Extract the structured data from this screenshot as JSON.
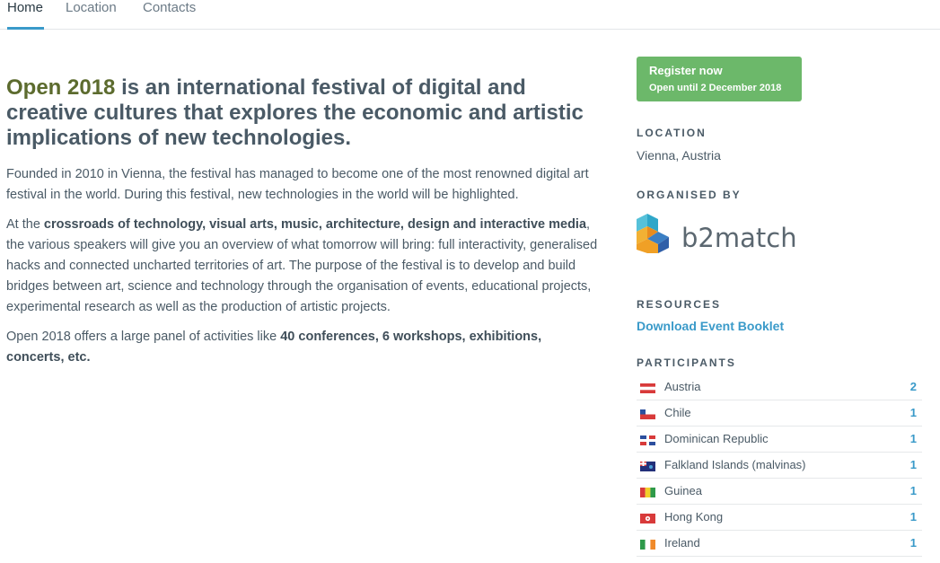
{
  "nav": {
    "tabs": [
      {
        "label": "Home",
        "active": true
      },
      {
        "label": "Location",
        "active": false
      },
      {
        "label": "Contacts",
        "active": false
      }
    ]
  },
  "main": {
    "headline_accent": "Open 2018",
    "headline_rest": " is an international festival of digital and creative cultures that explores the economic and artistic implications of new technologies.",
    "p1": "Founded in 2010 in Vienna, the festival has managed to become one of the most renowned digital art festival in the world. During this festival, new technologies in the world will be highlighted.",
    "p2_a": "At the ",
    "p2_b": "crossroads of technology, visual arts, music, architecture, design and interactive media",
    "p2_c": ", the various speakers will give you an overview of what tomorrow will bring: full interactivity, generalised hacks and connected uncharted territories of art. The purpose of the festival is to develop and build bridges between art, science and technology through the organisation of events, educational projects, experimental research as well as the production of artistic projects.",
    "p3_a": "Open 2018 offers a large panel of activities like ",
    "p3_b": "40 conferences, 6 workshops, exhibitions, concerts, etc."
  },
  "sidebar": {
    "register": {
      "title": "Register now",
      "subtitle": "Open until 2 December 2018"
    },
    "location": {
      "title": "LOCATION",
      "value": "Vienna, Austria"
    },
    "organised": {
      "title": "ORGANISED BY",
      "logo_text": "b2match"
    },
    "resources": {
      "title": "RESOURCES",
      "link": "Download Event Booklet"
    },
    "participants": {
      "title": "PARTICIPANTS",
      "rows": [
        {
          "name": "Austria",
          "count": "2"
        },
        {
          "name": "Chile",
          "count": "1"
        },
        {
          "name": "Dominican Republic",
          "count": "1"
        },
        {
          "name": "Falkland Islands (malvinas)",
          "count": "1"
        },
        {
          "name": "Guinea",
          "count": "1"
        },
        {
          "name": "Hong Kong",
          "count": "1"
        },
        {
          "name": "Ireland",
          "count": "1"
        }
      ]
    }
  },
  "colors": {
    "accent_blue": "#3a9ac9",
    "register_green": "#6cb86a",
    "headline_accent": "#5c6b2e"
  }
}
